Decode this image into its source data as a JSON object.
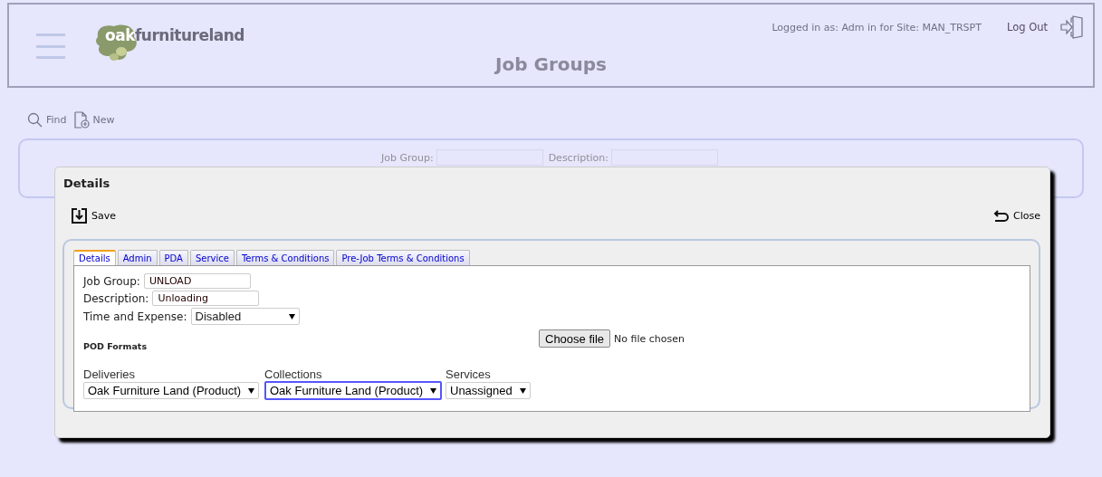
{
  "header": {
    "logo": {
      "part_1": "oak",
      "part_2": "furnitureland"
    },
    "title": "Job Groups",
    "login_info": "Logged in as:  Adm in for Site:  MAN_TRSPT",
    "logout": "Log Out"
  },
  "toolbar": [
    {
      "kind": "find",
      "label": "Find"
    },
    {
      "kind": "new",
      "label": "New"
    }
  ],
  "search": {
    "fields": [
      {
        "label": "Job Group:"
      },
      {
        "label": "Description:"
      }
    ]
  },
  "dialog": {
    "title": "Details",
    "save": "Save",
    "close": "Close",
    "tabs": [
      {
        "label": "Details",
        "selected": true
      },
      {
        "label": "Admin",
        "selected": false
      },
      {
        "label": "PDA",
        "selected": false
      },
      {
        "label": "Service",
        "selected": false
      },
      {
        "label": "Terms & Conditions",
        "selected": false
      },
      {
        "label": "Pre-Job Terms & Conditions",
        "selected": false
      }
    ],
    "fields": [
      {
        "kind": "text",
        "label": "Job Group:",
        "value": "UNLOAD"
      },
      {
        "kind": "text",
        "label": "Description:",
        "value": "Unloading"
      },
      {
        "kind": "select",
        "label": "Time and Expense:",
        "value": "Disabled"
      }
    ],
    "file": {
      "button": "Choose file",
      "status": "No file chosen"
    },
    "pod_heading": "POD Formats",
    "pod_formats": [
      {
        "label": "Deliveries",
        "value": "Oak Furniture Land (Product)",
        "focused": false
      },
      {
        "label": "Collections",
        "value": "Oak Furniture Land (Product)",
        "focused": true
      },
      {
        "label": "Services",
        "value": "Unassigned",
        "focused": false
      }
    ]
  }
}
